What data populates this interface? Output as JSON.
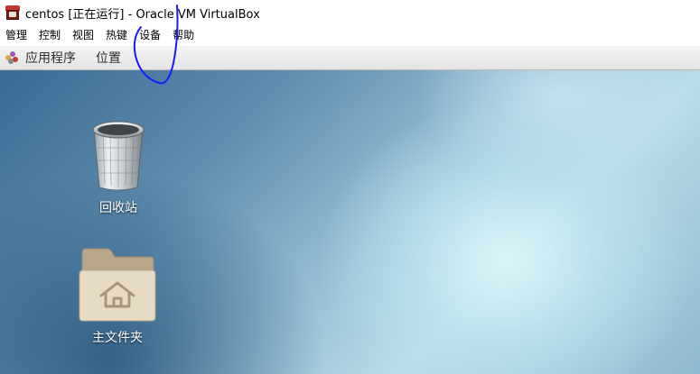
{
  "window": {
    "title": "centos [正在运行] - Oracle VM VirtualBox"
  },
  "menubar": {
    "items": [
      {
        "label": "管理"
      },
      {
        "label": "控制"
      },
      {
        "label": "视图"
      },
      {
        "label": "热键"
      },
      {
        "label": "设备"
      },
      {
        "label": "帮助"
      }
    ]
  },
  "guest_panel": {
    "applications_label": "应用程序",
    "places_label": "位置"
  },
  "desktop": {
    "icons": [
      {
        "label": "回收站",
        "icon": "trash-icon"
      },
      {
        "label": "主文件夹",
        "icon": "home-folder-icon"
      }
    ]
  },
  "colors": {
    "annotation_stroke": "#1a1aff"
  }
}
